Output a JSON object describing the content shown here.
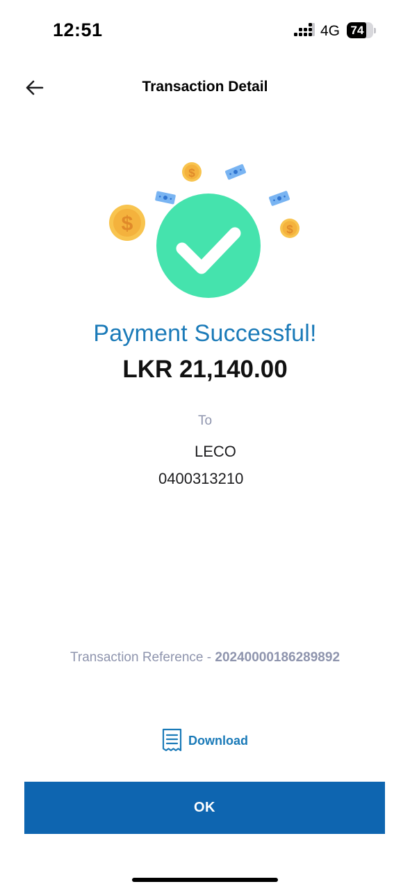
{
  "status_bar": {
    "time": "12:51",
    "network": "4G",
    "battery_level": "74",
    "battery_fraction": 0.74
  },
  "header": {
    "title": "Transaction Detail",
    "back_icon": "arrow-left-icon"
  },
  "result": {
    "title": "Payment Successful!",
    "amount": "LKR 21,140.00",
    "to_label": "To",
    "payee_name": "LECO",
    "account_number": "0400313210",
    "reference_label": "Transaction Reference - ",
    "reference_number": "20240000186289892"
  },
  "actions": {
    "download_label": "Download",
    "download_icon": "receipt-icon",
    "ok_label": "OK"
  },
  "colors": {
    "accent": "#1a7ab8",
    "primary_button": "#0e65b0",
    "success_green": "#45e3ad",
    "coin_gold": "#f8c44f",
    "muted_text": "#8e94ad"
  }
}
